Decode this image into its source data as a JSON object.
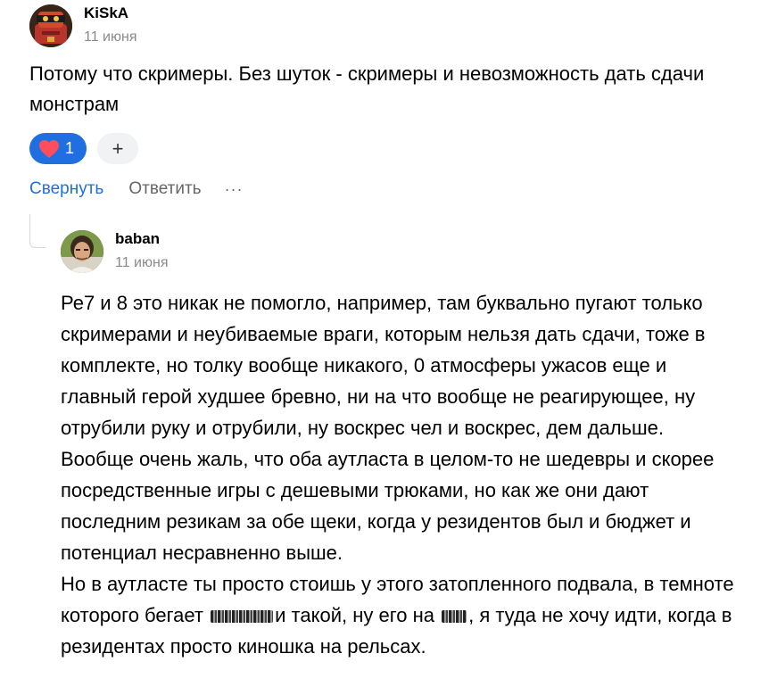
{
  "comment": {
    "author": "KiSkA",
    "date": "11 июня",
    "avatar_icon": "robot-avatar-icon",
    "text": "Потому что скримеры. Без шуток - скримеры и невозможность дать сдачи монстрам",
    "reactions": {
      "like_icon": "heart-icon",
      "like_count": "1",
      "add_label": "+"
    },
    "actions": {
      "collapse": "Свернуть",
      "reply": "Ответить",
      "more": "···"
    }
  },
  "reply": {
    "author": "baban",
    "date": "11 июня",
    "avatar_icon": "person-avatar-icon",
    "paragraph1": "Ре7 и 8 это никак не помогло, например, там буквально пугают только скримерами и неубиваемые враги, которым нельзя дать сдачи, тоже в комплекте, но толку вообще никакого, 0 атмосферы ужасов еще и главный герой худшее бревно, ни на что вообще не реагирующее, ну отрубили руку и отрубили, ну воскрес чел и воскрес, дем дальше. Вообще очень жаль, что оба аутласта в целом-то не шедевры и скорее посредственные игры с дешевыми трюками, но как же они дают последним резикам за обе щеки, когда у резидентов был и бюджет и потенциал несравненно выше.",
    "paragraph2_part1": "Но в аутласте ты просто стоишь у этого затопленного подвала, в темноте которого бегает",
    "paragraph2_part2": "и такой, ну его на",
    "paragraph2_part3": ", я туда не хочу идти, когда в резидентах просто киношка на рельсах."
  },
  "colors": {
    "accent": "#1f6fe0",
    "muted": "#8a8a8a",
    "action_gray": "#666666",
    "pill_bg": "#f1f2f4"
  }
}
